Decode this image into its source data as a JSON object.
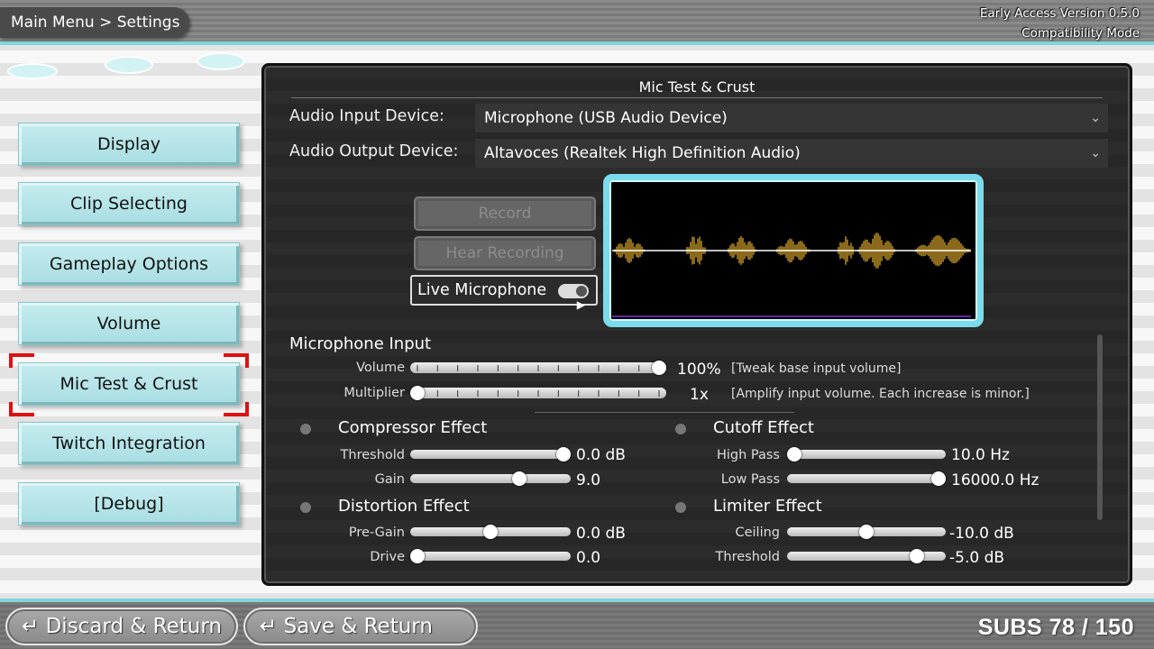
{
  "header": {
    "breadcrumb": "Main Menu > Settings",
    "version": "Early Access Version 0.5.0",
    "mode": "Compatibility Mode"
  },
  "sidebar": {
    "items": [
      {
        "label": "Display"
      },
      {
        "label": "Clip Selecting"
      },
      {
        "label": "Gameplay Options"
      },
      {
        "label": "Volume"
      },
      {
        "label": "Mic Test & Crust"
      },
      {
        "label": "Twitch Integration"
      },
      {
        "label": "[Debug]"
      }
    ],
    "selected": "Mic Test & Crust"
  },
  "panel": {
    "title": "Mic Test & Crust",
    "input_device_label": "Audio Input Device:",
    "input_device_value": "Microphone (USB Audio Device)",
    "output_device_label": "Audio Output Device:",
    "output_device_value": "Altavoces (Realtek High Definition Audio)",
    "record_label": "Record",
    "hear_label": "Hear Recording",
    "live_label": "Live Microphone",
    "live_on": true,
    "mic_section": "Microphone Input",
    "volume_label": "Volume",
    "volume_value": "100%",
    "volume_note": "[Tweak base input volume]",
    "volume_level": 1.0,
    "multiplier_label": "Multiplier",
    "multiplier_value": "1x",
    "multiplier_note": "[Amplify input volume. Each increase is minor.]",
    "multiplier_level": 0.0,
    "compressor": {
      "title": "Compressor Effect",
      "threshold_label": "Threshold",
      "threshold_value": "0.0 dB",
      "threshold_level": 1.0,
      "gain_label": "Gain",
      "gain_value": "9.0",
      "gain_level": 0.7
    },
    "cutoff": {
      "title": "Cutoff Effect",
      "highpass_label": "High Pass",
      "highpass_value": "10.0 Hz",
      "highpass_level": 0.0,
      "lowpass_label": "Low Pass",
      "lowpass_value": "16000.0 Hz",
      "lowpass_level": 1.0
    },
    "distortion": {
      "title": "Distortion Effect",
      "pregain_label": "Pre-Gain",
      "pregain_value": "0.0 dB",
      "pregain_level": 0.5,
      "drive_label": "Drive",
      "drive_value": "0.0",
      "drive_level": 0.0
    },
    "limiter": {
      "title": "Limiter Effect",
      "ceiling_label": "Ceiling",
      "ceiling_value": "-10.0 dB",
      "ceiling_level": 0.5,
      "threshold_label": "Threshold",
      "threshold_value": "-5.0 dB",
      "threshold_level": 0.85
    }
  },
  "footer": {
    "discard_label": "Discard & Return",
    "save_label": "Save & Return",
    "subs": "SUBS 78 / 150"
  },
  "colors": {
    "accent": "#7fd6dc",
    "selection": "#e01010",
    "waveform": "#8a6a1a"
  },
  "icons": {
    "return": "return-arrow-icon",
    "dropdown": "chevron-down-icon"
  }
}
